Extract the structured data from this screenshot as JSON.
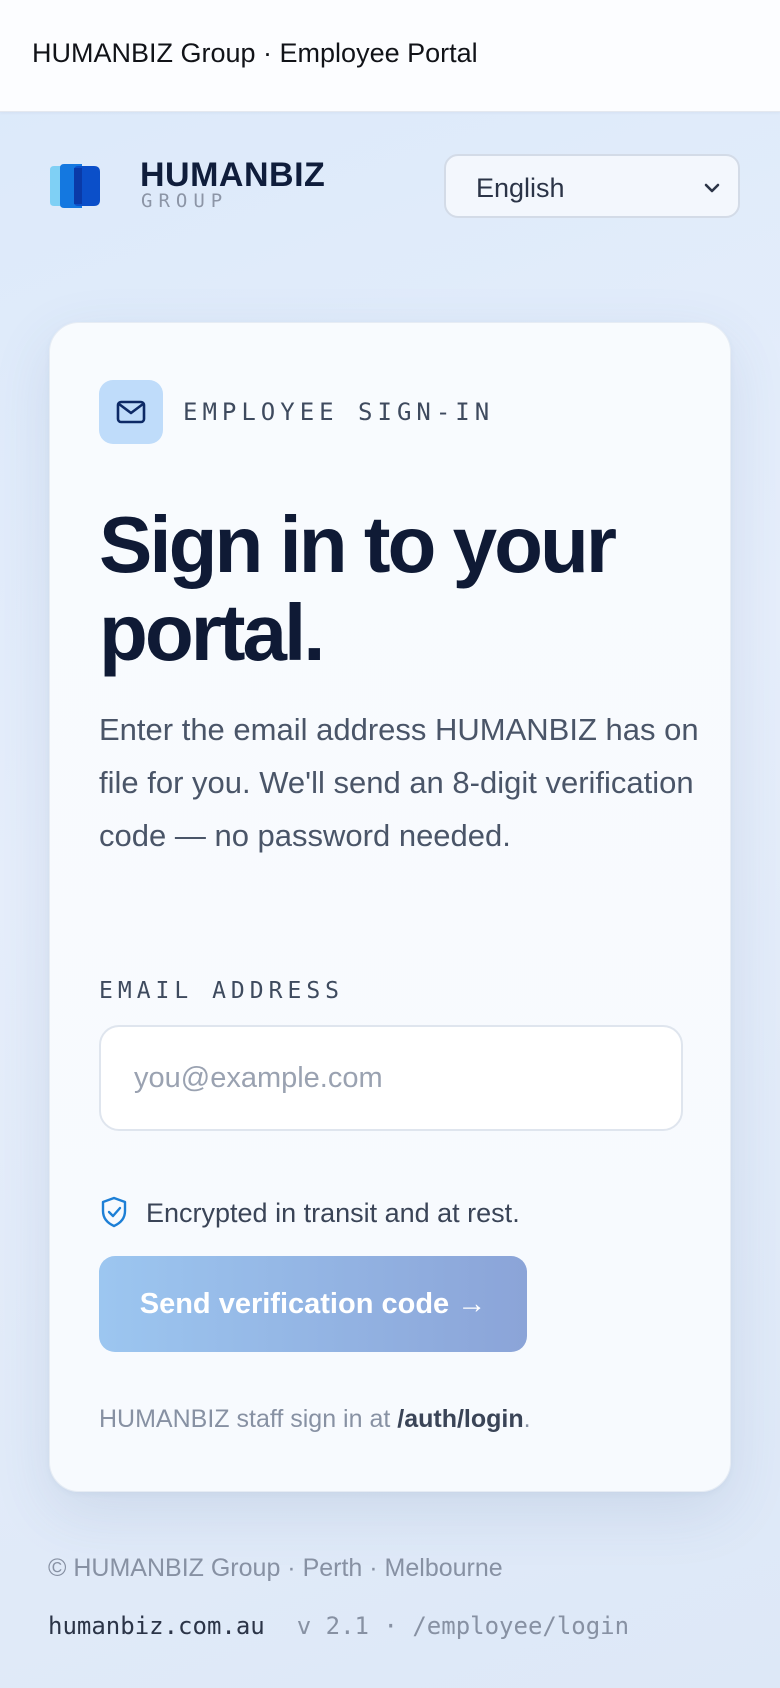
{
  "window": {
    "title": "HUMANBIZ Group · Employee Portal"
  },
  "brand": {
    "name": "HUMANBIZ",
    "sub": "GROUP",
    "logo_icon": "stacked-hexagons-logo"
  },
  "language": {
    "selected": "English",
    "icon": "chevron-down-icon"
  },
  "card": {
    "eyebrow": "EMPLOYEE SIGN-IN",
    "eyebrow_icon": "mail-icon",
    "headline_line1": "Sign in to your",
    "headline_line2": "portal.",
    "description": "Enter the email address HUMANBIZ has on file for you. We'll send an 8-digit verification code — no password needed.",
    "email_label": "EMAIL ADDRESS",
    "email_value": "",
    "email_placeholder": "you@example.com",
    "security_note": "Encrypted in transit and at rest.",
    "security_icon": "shield-check-icon",
    "submit_label": "Send verification code →",
    "staff_note_prefix": "HUMANBIZ staff sign in at ",
    "staff_note_link": "/auth/login",
    "staff_note_suffix": "."
  },
  "footer": {
    "copyright": "© HUMANBIZ Group · Perth · Melbourne",
    "domain": "humanbiz.com.au",
    "version": "v 2.1 · /employee/login"
  },
  "colors": {
    "accent": "#0b5fd6",
    "heading": "#0f1a35",
    "button_start": "#9cc6f0",
    "button_end": "#8ba4d8"
  }
}
